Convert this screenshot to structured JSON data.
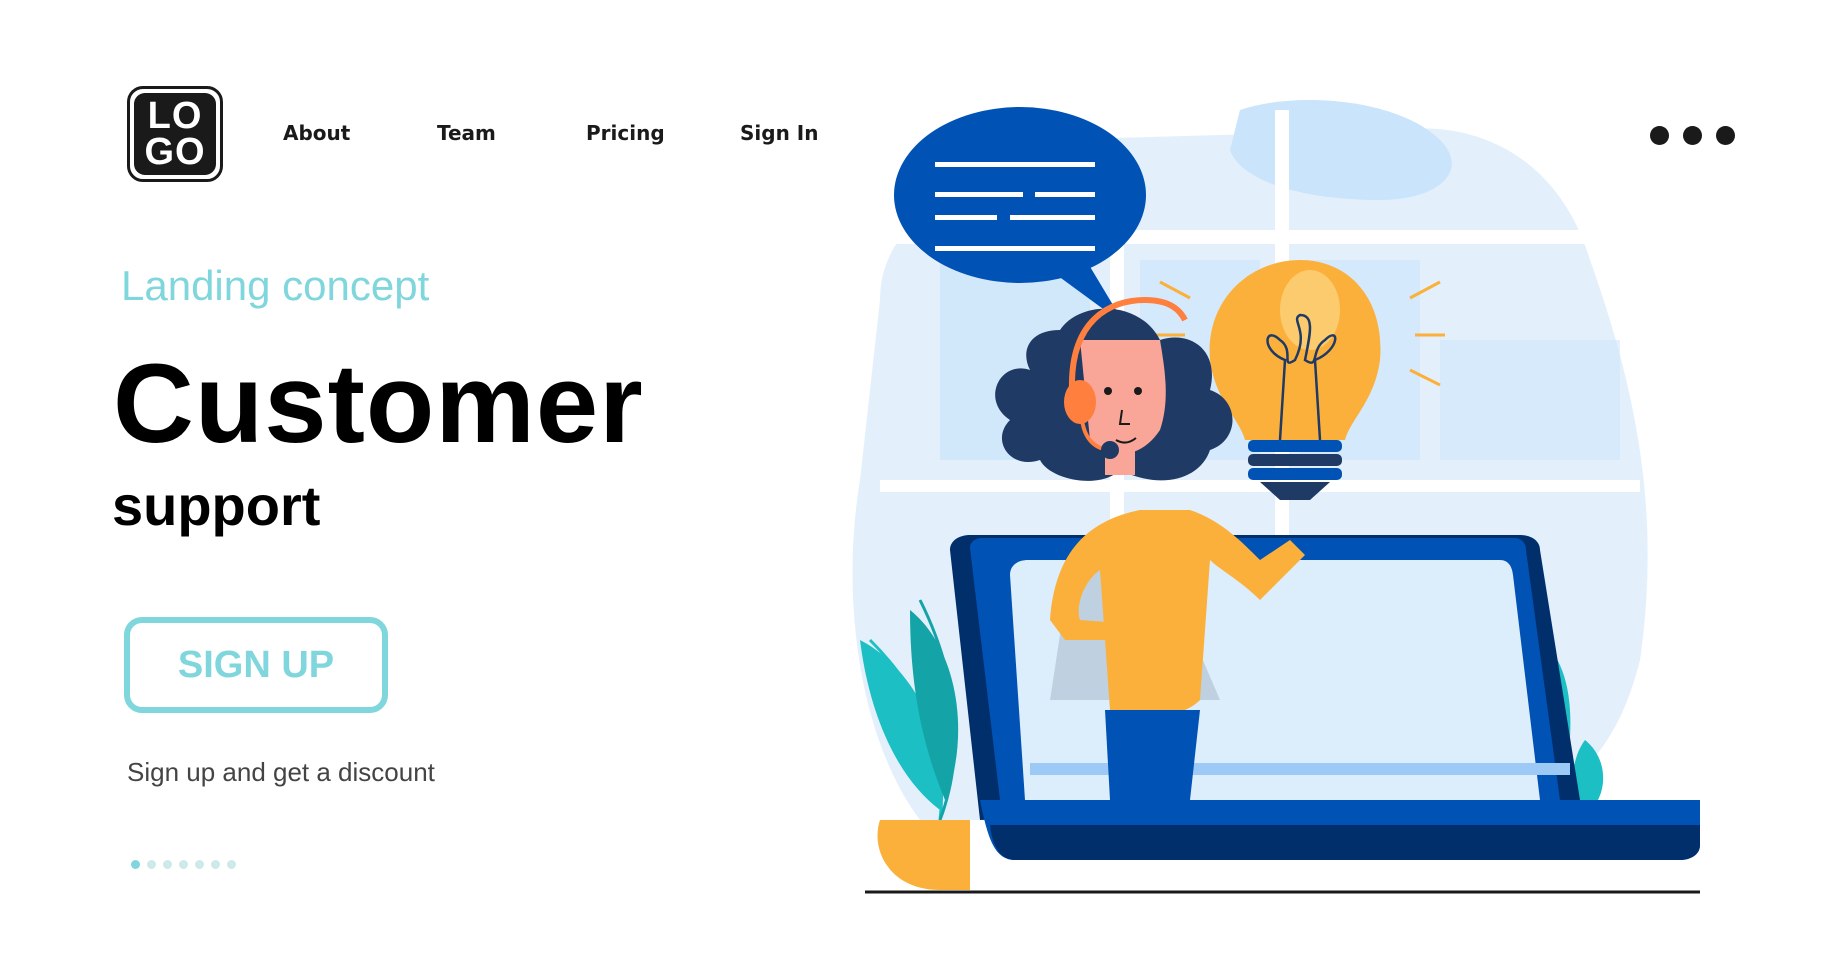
{
  "logo": {
    "lines": [
      "LO",
      "GO"
    ]
  },
  "nav": {
    "items": [
      {
        "label": "About"
      },
      {
        "label": "Team"
      },
      {
        "label": "Pricing"
      },
      {
        "label": "Sign In"
      }
    ],
    "more_icon": "more-horizontal-icon"
  },
  "hero": {
    "eyebrow": "Landing concept",
    "title": "Customer",
    "subtitle": "support",
    "cta_label": "SIGN UP",
    "hint": "Sign up and get a discount"
  },
  "pagination": {
    "total": 7,
    "active_index": 0
  },
  "colors": {
    "accent": "#7fd6dc",
    "text": "#000000",
    "muted_text": "#444444",
    "dot_inactive": "#cfe8e8",
    "illustration_blue": "#0052b4",
    "illustration_navy": "#1f3a64",
    "illustration_yellow": "#fbb03b",
    "illustration_sky": "#c9e4fb",
    "illustration_teal": "#1bbfc4"
  },
  "illustration": {
    "description": "Customer support agent with headset emerging from laptop, speech bubble and light bulb",
    "icons": [
      "speech-bubble-icon",
      "light-bulb-icon",
      "laptop-icon",
      "headset-icon",
      "plant-icon"
    ]
  }
}
